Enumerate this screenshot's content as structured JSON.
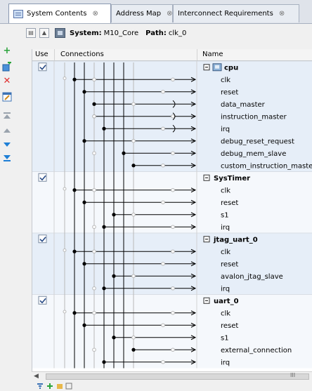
{
  "tabs": [
    {
      "label": "System Contents",
      "close": "⊗"
    },
    {
      "label": "Address Map",
      "close": "⊗"
    },
    {
      "label": "Interconnect Requirements",
      "close": "⊗"
    }
  ],
  "path_bar": {
    "system_label": "System:",
    "system_value": "M10_Core",
    "path_label": "Path:",
    "path_value": "clk_0"
  },
  "toolbar": [
    "add-icon",
    "add-connection-icon",
    "remove-icon",
    "edit-icon",
    "move-top-icon",
    "move-up-icon",
    "move-down-icon",
    "move-bottom-icon"
  ],
  "table": {
    "columns": {
      "use": "Use",
      "connections": "Connections",
      "name": "Name"
    },
    "components": [
      {
        "name": "cpu",
        "use": true,
        "icon": "processor-icon",
        "ports": [
          "clk",
          "reset",
          "data_master",
          "instruction_master",
          "irq",
          "debug_reset_request",
          "debug_mem_slave",
          "custom_instruction_master"
        ]
      },
      {
        "name": "SysTimer",
        "use": true,
        "ports": [
          "clk",
          "reset",
          "s1",
          "irq"
        ]
      },
      {
        "name": "jtag_uart_0",
        "use": true,
        "ports": [
          "clk",
          "reset",
          "avalon_jtag_slave",
          "irq"
        ]
      },
      {
        "name": "uart_0",
        "use": true,
        "ports": [
          "clk",
          "reset",
          "s1",
          "external_connection",
          "irq"
        ]
      }
    ]
  },
  "scrollbar": {
    "grip": "III"
  },
  "colors": {
    "select": "#e6eef8",
    "line": "#000000",
    "faint": "#b9b9b9",
    "tree_bg": "#ffffff"
  }
}
